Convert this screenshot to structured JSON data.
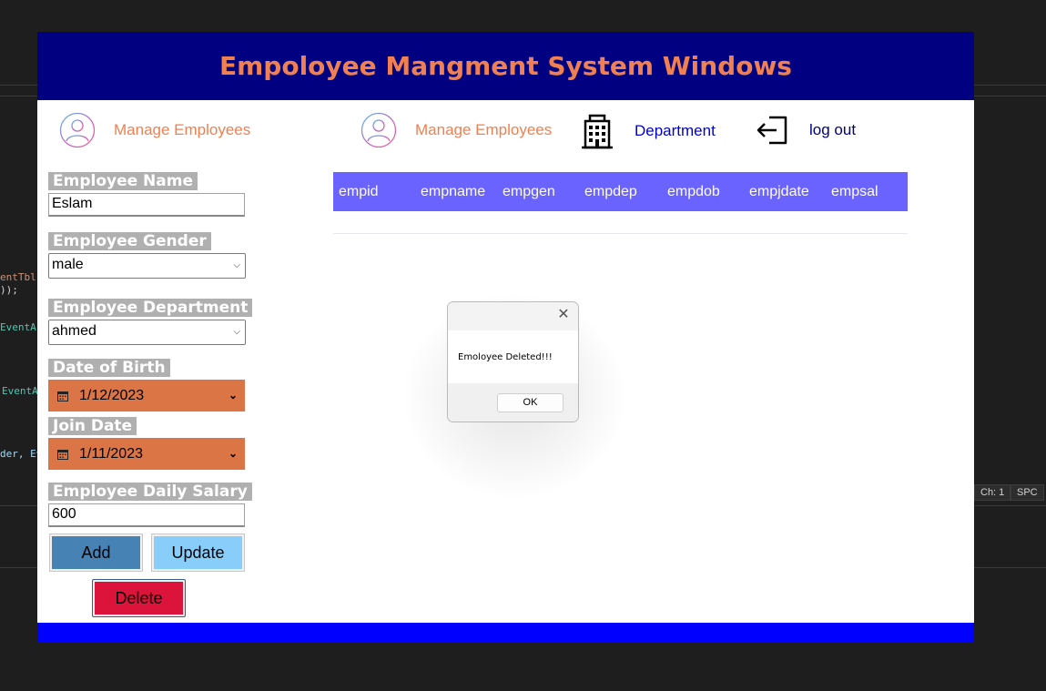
{
  "background_ide": {
    "code_snippets": [
      "entTbl\"",
      "));",
      "EventArg",
      "EventAr",
      "der, Eve"
    ],
    "status_ch": "Ch: 1",
    "status_spc": "SPC"
  },
  "app": {
    "title": "Empoloyee Mangment System Windows",
    "nav": {
      "left_manage_employees": "Manage Employees",
      "manage_employees": "Manage Employees",
      "department": "Department",
      "logout": "log out"
    },
    "form": {
      "employee_name": {
        "label": "Employee Name",
        "value": "Eslam"
      },
      "employee_gender": {
        "label": "Employee Gender",
        "value": "male"
      },
      "employee_department": {
        "label": "Employee Department",
        "value": "ahmed"
      },
      "date_of_birth": {
        "label": "Date of Birth",
        "value": "1/12/2023"
      },
      "join_date": {
        "label": "Join Date",
        "value": "1/11/2023"
      },
      "daily_salary": {
        "label": "Employee Daily Salary",
        "value": "600"
      }
    },
    "buttons": {
      "add": "Add",
      "update": "Update",
      "delete": "Delete"
    },
    "grid": {
      "columns": [
        "empid",
        "empname",
        "empgen",
        "empdep",
        "empdob",
        "empjdate",
        "empsal"
      ]
    }
  },
  "dialog": {
    "message": "Emoloyee Deleted!!!",
    "ok": "OK",
    "close_symbol": "✕"
  },
  "colors": {
    "title_bar": "#000080",
    "title_text": "#f08050",
    "grid_header": "#6a63ff",
    "date_picker": "#db7545",
    "add_button": "#4682b4",
    "update_button": "#87cefa",
    "delete_button": "#dc143c",
    "bottom_bar": "#0000ff"
  }
}
